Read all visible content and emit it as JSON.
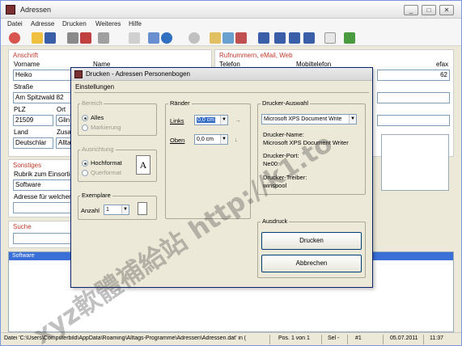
{
  "window": {
    "title": "Adressen",
    "controls": [
      "_",
      "□",
      "✕"
    ]
  },
  "menu": [
    "Datei",
    "Adresse",
    "Drucken",
    "Weiteres",
    "Hilfe"
  ],
  "main": {
    "anschrift": {
      "label": "Anschrift",
      "vorname_label": "Vorname",
      "vorname": "Heiko",
      "name_label": "Name",
      "strasse_label": "Straße",
      "strasse": "Am Spitzwald 82",
      "plz_label": "PLZ",
      "plz": "21509",
      "ort_label": "Ort",
      "ort": "Glin",
      "land_label": "Land",
      "land": "Deutschlar",
      "zusatz_label": "Zusa",
      "zusatz": "Allta"
    },
    "rufnummern": {
      "label": "Rufnummern, eMail, Web",
      "telefon_label": "Telefon",
      "mobil_label": "Mobiltelefon",
      "fax_label": "efax",
      "fax_value": "62"
    },
    "sonstiges": {
      "label": "Sonstiges",
      "rubrik_label": "Rubrik zum Einsortier",
      "rubrik": "Software",
      "adresse_label": "Adresse für welchen"
    },
    "suche": {
      "label": "Suche"
    },
    "list": {
      "selected_row": "Software"
    }
  },
  "status": {
    "file": "Datei 'C:\\Users\\Computerbild\\AppData\\Roaming\\Alltags-Programme\\Adressen\\Adressen.dat' in (",
    "pos": "Pos. 1 von 1",
    "sel": "Sel -",
    "num": "#1",
    "date": "05.07.2011",
    "time": "11:37"
  },
  "dialog": {
    "title": "Drucken - Adressen Personenbogen",
    "section": "Einstellungen",
    "bereich": {
      "label": "Bereich",
      "alles": "Alles",
      "markierung": "Markierung"
    },
    "ausrichtung": {
      "label": "Ausrichtung",
      "hochformat": "Hochformat",
      "querformat": "Querformat"
    },
    "exemplare": {
      "label": "Exemplare",
      "anzahl_label": "Anzahl",
      "anzahl": "1"
    },
    "raender": {
      "label": "Ränder",
      "links_label": "Links",
      "links": "0,0 cm",
      "oben_label": "Oben",
      "oben": "0,0 cm"
    },
    "drucker": {
      "label": "Drucker-Auswahl",
      "selected": "Microsoft XPS Document Write",
      "name_label": "Drucker-Name:",
      "name": "Microsoft XPS Document Writer",
      "port_label": "Drucker-Port:",
      "port": "Ne00:",
      "treiber_label": "Drucker-Treiber:",
      "treiber": "winspool"
    },
    "ausdruck": {
      "label": "Ausdruck",
      "drucken": "Drucken",
      "abbrechen": "Abbrechen"
    }
  },
  "watermark": "xyz軟體補給站 http://k1.to",
  "colors": {
    "section_label": "#c0392b",
    "selection": "#316ac5",
    "list_selection": "#3a6fd8"
  }
}
